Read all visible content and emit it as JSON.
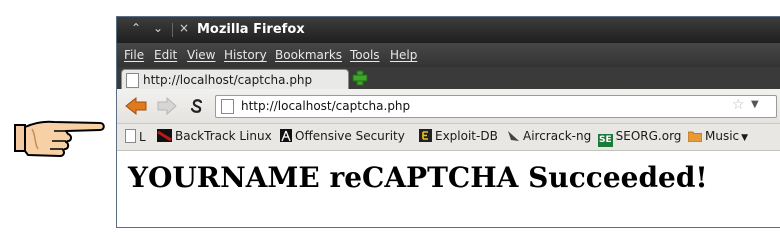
{
  "window": {
    "title": "Mozilla Firefox"
  },
  "menubar": {
    "items": [
      "File",
      "Edit",
      "View",
      "History",
      "Bookmarks",
      "Tools",
      "Help"
    ]
  },
  "tab": {
    "label": "http://localhost/captcha.php"
  },
  "urlbar": {
    "value": "http://localhost/captcha.php"
  },
  "bookmarks": [
    {
      "label": "L",
      "icon": "page-icon"
    },
    {
      "label": "BackTrack Linux",
      "icon": "backtrack-icon"
    },
    {
      "label": "Offensive Security",
      "icon": "offsec-icon"
    },
    {
      "label": "Exploit-DB",
      "icon": "exploitdb-icon"
    },
    {
      "label": "Aircrack-ng",
      "icon": "aircrack-icon"
    },
    {
      "label": "SEORG.org",
      "icon": "seorg-icon",
      "icon_text": "SE"
    },
    {
      "label": "Music",
      "icon": "folder-icon"
    }
  ],
  "page": {
    "heading": "YOURNAME reCAPTCHA Succeeded!"
  },
  "colors": {
    "titlebar": "#2b2b2b",
    "back_arrow": "#e07a1f",
    "newtab": "#3fa52b"
  }
}
